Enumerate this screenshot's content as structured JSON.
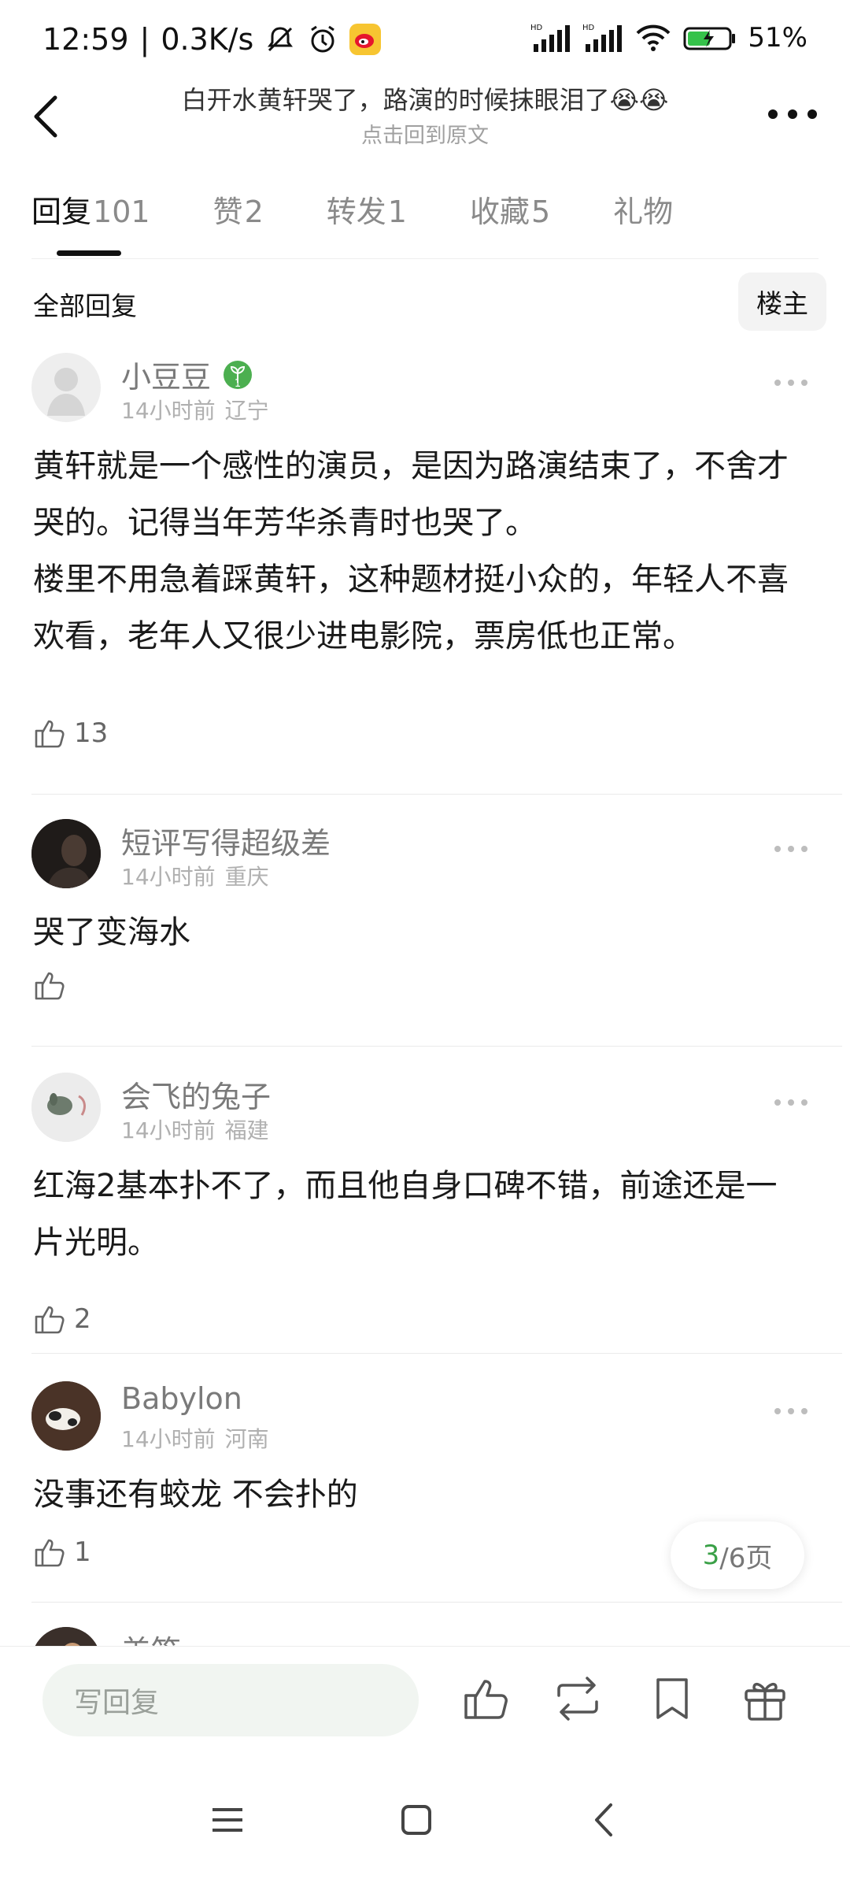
{
  "status_bar": {
    "time": "12:59",
    "separator": "|",
    "net_speed": "0.3K/s",
    "battery": "51%"
  },
  "header": {
    "title": "白开水黄轩哭了，路演的时候抹眼泪了😭😭",
    "subtitle": "点击回到原文"
  },
  "tabs": [
    {
      "label": "回复",
      "count": "101"
    },
    {
      "label": "赞",
      "count": "2"
    },
    {
      "label": "转发",
      "count": "1"
    },
    {
      "label": "收藏",
      "count": "5"
    },
    {
      "label": "礼物",
      "count": ""
    }
  ],
  "filter": {
    "label": "全部回复",
    "owner_button": "楼主"
  },
  "replies": [
    {
      "username": "小豆豆",
      "badge": "1",
      "time": "14小时前",
      "location": "辽宁",
      "text": "黄轩就是一个感性的演员，是因为路演结束了，不舍才哭的。记得当年芳华杀青时也哭了。\n楼里不用急着踩黄轩，这种题材挺小众的，年轻人不喜欢看，老年人又很少进电影院，票房低也正常。",
      "likes": "13"
    },
    {
      "username": "短评写得超级差",
      "time": "14小时前",
      "location": "重庆",
      "text": "哭了变海水",
      "likes": ""
    },
    {
      "username": "会飞的兔子",
      "time": "14小时前",
      "location": "福建",
      "text": "红海2基本扑不了，而且他自身口碑不错，前途还是一片光明。",
      "likes": "2"
    },
    {
      "username": "Babylon",
      "time": "14小时前",
      "location": "河南",
      "text": "没事还有蛟龙 不会扑的",
      "likes": "1"
    },
    {
      "username": "羌笛"
    }
  ],
  "pagination": {
    "current": "3",
    "total_text": "/6页"
  },
  "bottom_bar": {
    "reply_placeholder": "写回复"
  },
  "colors": {
    "accent_green": "#3aa047",
    "badge_green": "#4caf50"
  }
}
